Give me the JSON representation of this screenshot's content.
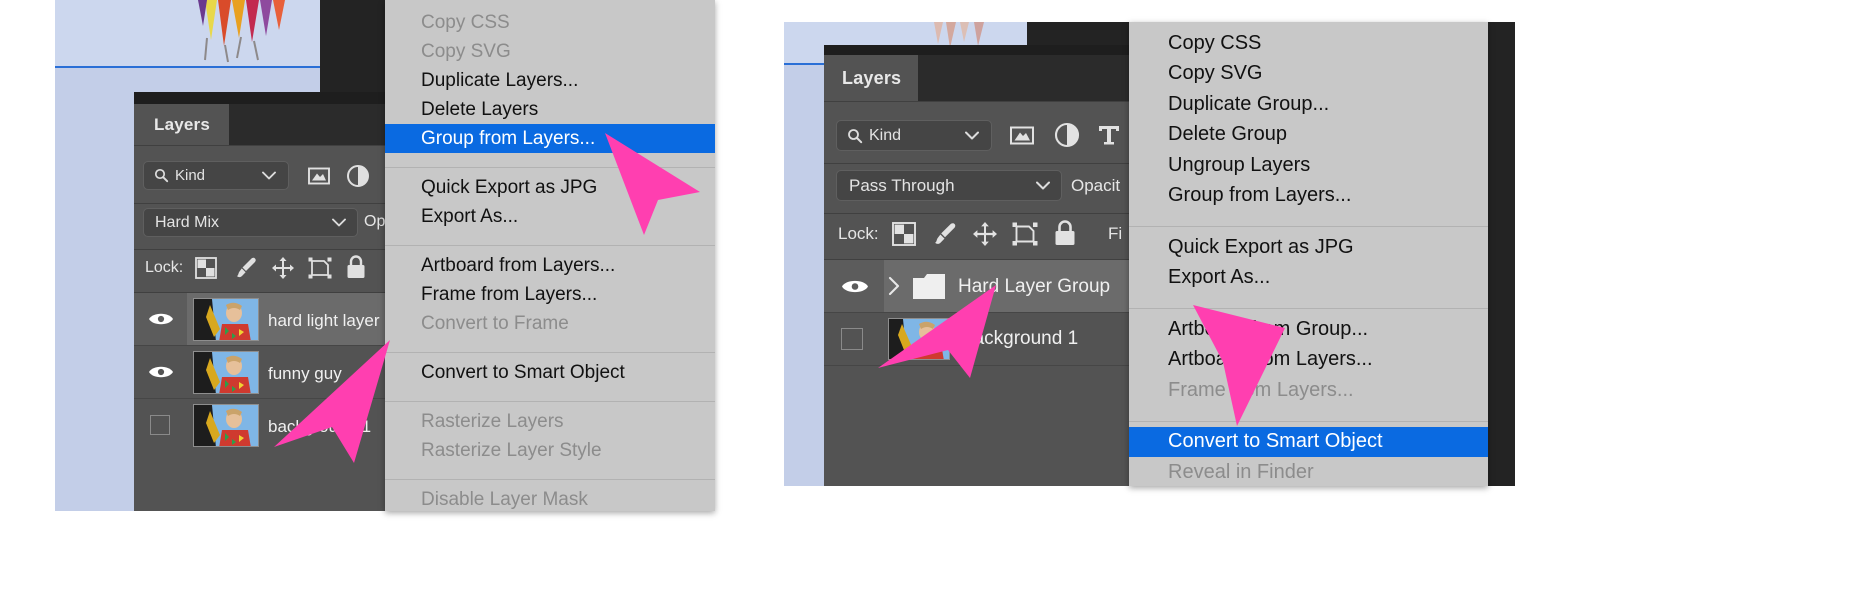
{
  "meta": {
    "app": "Adobe Photoshop",
    "accent_highlight": "#0a6ae1",
    "menu_bg": "#c8c8c8",
    "panel_bg": "#535353",
    "arrow_color": "#ff3fb0"
  },
  "left": {
    "panel": {
      "tab_label": "Layers",
      "filter": {
        "search_icon": "search-icon",
        "value": "Kind",
        "chevron": "chevron-down-icon"
      },
      "filter_icons": [
        "image-icon",
        "adjustment-icon"
      ],
      "blend_mode": "Hard Mix",
      "opacity_label": "Op",
      "lock_label": "Lock:",
      "lock_icons": [
        "transparency-lock-icon",
        "brush-lock-icon",
        "move-lock-icon",
        "artboard-lock-icon",
        "lock-all-icon"
      ],
      "layers": [
        {
          "name": "hard light layer",
          "visible": true,
          "selected": true,
          "thumb": "portrait-thumb"
        },
        {
          "name": "funny guy",
          "visible": true,
          "selected": false,
          "thumb": "portrait-thumb"
        },
        {
          "name": "background 1",
          "visible": false,
          "selected": false,
          "thumb": "portrait-thumb"
        }
      ]
    },
    "menu": {
      "items": [
        {
          "label": "Copy CSS",
          "state": "disabled"
        },
        {
          "label": "Copy SVG",
          "state": "disabled"
        },
        {
          "label": "Duplicate Layers...",
          "state": "normal"
        },
        {
          "label": "Delete Layers",
          "state": "normal"
        },
        {
          "label": "Group from Layers...",
          "state": "highlight"
        },
        {
          "label": "divider",
          "state": "divider"
        },
        {
          "label": "Quick Export as JPG",
          "state": "normal"
        },
        {
          "label": "Export As...",
          "state": "normal"
        },
        {
          "label": "divider",
          "state": "divider"
        },
        {
          "label": "Artboard from Layers...",
          "state": "normal"
        },
        {
          "label": "Frame from Layers...",
          "state": "normal"
        },
        {
          "label": "Convert to Frame",
          "state": "disabled"
        },
        {
          "label": "divider",
          "state": "divider"
        },
        {
          "label": "Convert to Smart Object",
          "state": "normal"
        },
        {
          "label": "divider",
          "state": "divider"
        },
        {
          "label": "Rasterize Layers",
          "state": "disabled"
        },
        {
          "label": "Rasterize Layer Style",
          "state": "disabled"
        },
        {
          "label": "divider",
          "state": "divider"
        },
        {
          "label": "Disable Layer Mask",
          "state": "disabled"
        }
      ]
    },
    "cursor": "pink-arrow-pointer"
  },
  "right": {
    "panel": {
      "tab_label": "Layers",
      "filter": {
        "search_icon": "search-icon",
        "value": "Kind",
        "chevron": "chevron-down-icon"
      },
      "filter_icons": [
        "image-icon",
        "adjustment-icon",
        "type-icon"
      ],
      "blend_mode": "Pass Through",
      "opacity_label": "Opacit",
      "lock_label": "Lock:",
      "fill_label": "Fi",
      "lock_icons": [
        "transparency-lock-icon",
        "brush-lock-icon",
        "move-lock-icon",
        "artboard-lock-icon",
        "lock-all-icon"
      ],
      "layers": [
        {
          "name": "Hard Layer Group",
          "visible": true,
          "selected": true,
          "type": "group",
          "expander": "chevron-right-icon"
        },
        {
          "name": "background 1",
          "visible": false,
          "selected": false,
          "type": "layer",
          "thumb": "portrait-thumb"
        }
      ]
    },
    "menu": {
      "items": [
        {
          "label": "Copy CSS",
          "state": "normal"
        },
        {
          "label": "Copy SVG",
          "state": "normal"
        },
        {
          "label": "Duplicate Group...",
          "state": "normal"
        },
        {
          "label": "Delete Group",
          "state": "normal"
        },
        {
          "label": "Ungroup Layers",
          "state": "normal"
        },
        {
          "label": "Group from Layers...",
          "state": "normal"
        },
        {
          "label": "divider",
          "state": "divider"
        },
        {
          "label": "Quick Export as JPG",
          "state": "normal"
        },
        {
          "label": "Export As...",
          "state": "normal"
        },
        {
          "label": "divider",
          "state": "divider"
        },
        {
          "label": "Artboard from Group...",
          "state": "normal"
        },
        {
          "label": "Artboard from Layers...",
          "state": "normal"
        },
        {
          "label": "Frame from Layers...",
          "state": "disabled"
        },
        {
          "label": "divider",
          "state": "divider"
        },
        {
          "label": "Convert to Smart Object",
          "state": "highlight"
        },
        {
          "label": "Reveal in Finder",
          "state": "disabled"
        }
      ]
    },
    "cursor": "pink-arrow-pointer"
  }
}
